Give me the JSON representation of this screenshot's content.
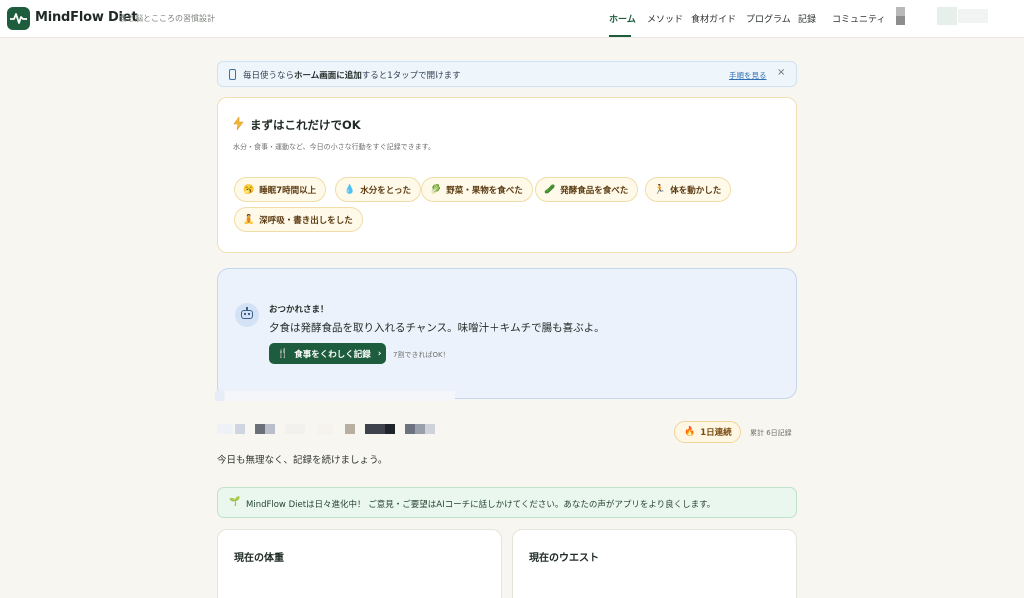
{
  "header": {
    "brand": "MindFlow Diet",
    "tagline": "食と脳とこころの習慣設計",
    "nav": [
      "ホーム",
      "メソッド",
      "食材ガイド",
      "プログラム",
      "記録",
      "コミュニティ"
    ],
    "active_nav": "ホーム"
  },
  "banner": {
    "text_pre": "毎日使うなら",
    "text_bold": "ホーム画面に追加",
    "text_post": "すると1タップで開けます",
    "link": "手順を見る",
    "close": "×"
  },
  "quick": {
    "title": "まずはこれだけでOK",
    "subtitle": "水分・食事・運動など、今日の小さな行動をすぐ記録できます。",
    "chips": [
      {
        "icon": "🥱",
        "label": "睡眠7時間以上"
      },
      {
        "icon": "💧",
        "label": "水分をとった"
      },
      {
        "icon": "🥬",
        "label": "野菜・果物を食べた"
      },
      {
        "icon": "🥒",
        "label": "発酵食品を食べた"
      },
      {
        "icon": "🏃",
        "label": "体を動かした"
      },
      {
        "icon": "🧘",
        "label": "深呼吸・書き出しをした"
      }
    ]
  },
  "coach": {
    "greeting": "おつかれさま！",
    "message": "夕食は発酵食品を取り入れるチャンス。味噌汁＋キムチで腸も喜ぶよ。",
    "button": "食事をくわしく記録",
    "note": "7割できればOK！"
  },
  "streak": {
    "badge": "1日連続",
    "total": "累計 6日記録"
  },
  "keep_message": "今日も無理なく、記録を続けましょう。",
  "notice": {
    "icon": "🌱",
    "text": "MindFlow Dietは日々進化中！ ご意見・ご要望はAIコーチに話しかけてください。あなたの声がアプリをより良くします。"
  },
  "stats": {
    "weight_title": "現在の体重",
    "waist_title": "現在のウエスト"
  },
  "colors": {
    "brand_green": "#1d5c3d",
    "page_bg": "#f8f6f1",
    "chip_bg": "#fff9e9",
    "coach_bg": "#ebf2fb",
    "notice_bg": "#eaf7ef"
  }
}
